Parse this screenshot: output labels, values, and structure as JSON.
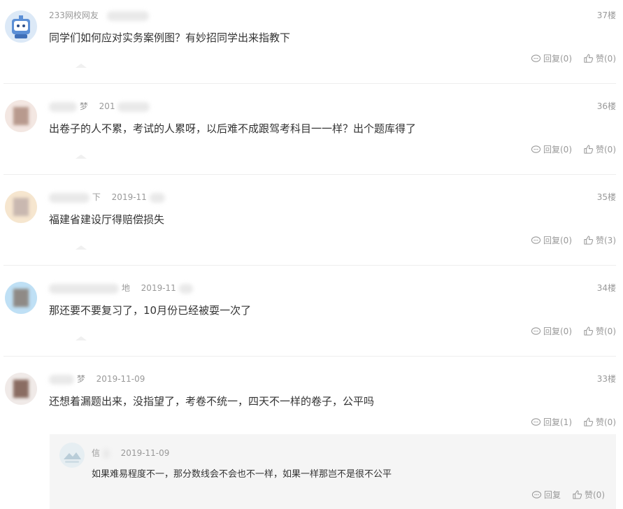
{
  "comments": [
    {
      "user": "233网校网友",
      "date": "",
      "floor": "37楼",
      "text": "同学们如何应对实务案例图？有妙招同学出来指教下",
      "reply": "回复(0)",
      "like": "赞(0)"
    },
    {
      "user": "梦",
      "date": "201",
      "floor": "36楼",
      "text": "出卷子的人不累，考试的人累呀，以后难不成跟驾考科目一一样？出个题库得了",
      "reply": "回复(0)",
      "like": "赞(0)"
    },
    {
      "user": "下",
      "date": "2019-11",
      "floor": "35楼",
      "text": "福建省建设厅得赔偿损失",
      "reply": "回复(0)",
      "like": "赞(3)"
    },
    {
      "user": "地",
      "date": "2019-11",
      "floor": "34楼",
      "text": "那还要不要复习了，10月份已经被耍一次了",
      "reply": "回复(0)",
      "like": "赞(0)"
    },
    {
      "user": "梦",
      "date": "2019-11-09",
      "floor": "33楼",
      "text": "还想着漏题出来，没指望了，考卷不统一，四天不一样的卷子，公平吗",
      "reply": "回复(1)",
      "like": "赞(0)"
    }
  ],
  "nested_reply": {
    "user": "信",
    "date": "2019-11-09",
    "text": "如果难易程度不一，那分数线会不会也不一样，如果一样那岂不是很不公平",
    "reply": "回复",
    "like": "赞(0)"
  },
  "colors": {
    "meta": "#999999",
    "text": "#333333",
    "divider": "#eeeeee",
    "reply_bg": "#f5f5f5"
  }
}
